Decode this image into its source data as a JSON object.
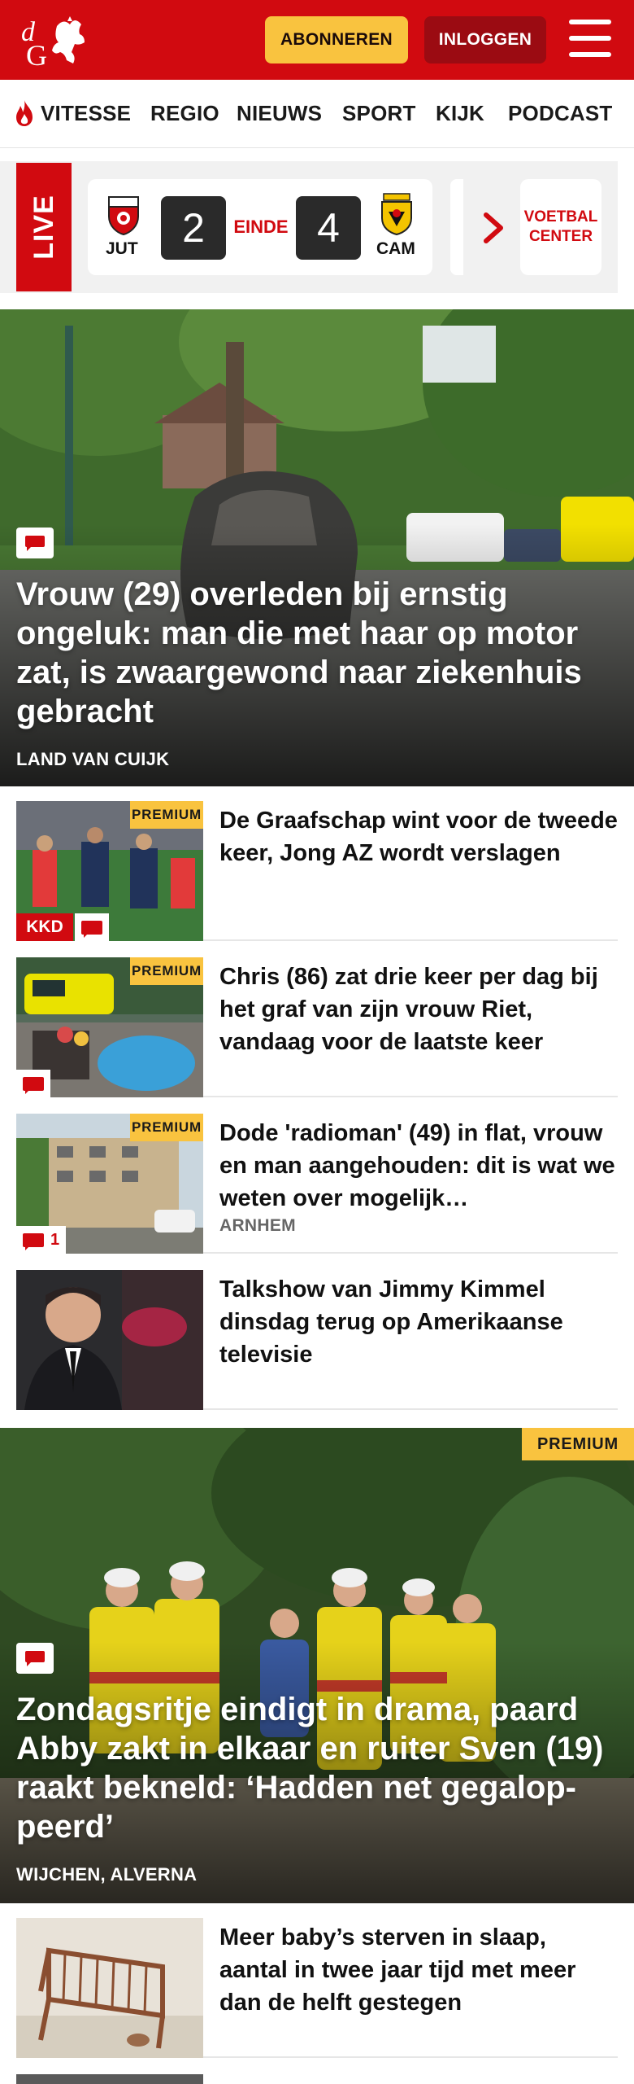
{
  "header": {
    "subscribe_label": "ABONNEREN",
    "login_label": "INLOGGEN",
    "brand_color": "#d10a10",
    "subscribe_color": "#f9c33f"
  },
  "nav": {
    "items": [
      "VITESSE",
      "REGIO",
      "NIEUWS",
      "SPORT",
      "KIJK",
      "PODCAST"
    ]
  },
  "live": {
    "label": "LIVE",
    "home_team": "JUT",
    "away_team": "CAM",
    "home_score": "2",
    "away_score": "4",
    "status": "EINDE",
    "voetbal_center": "VOETBAL CENTER"
  },
  "hero1": {
    "title": "Vrouw (29) overleden bij ernstig ongeluk: man die met haar op motor zat, is zwaargewond naar ziekenhuis gebracht",
    "location": "LAND VAN CUIJK"
  },
  "articles": [
    {
      "title": "De Graafschap wint voor de tweede keer, Jong AZ wordt verslagen",
      "premium": "PREMIUM",
      "badge": "KKD"
    },
    {
      "title": "Chris (86) zat drie keer per dag bij het graf van zijn vrouw Riet, vandaag voor de laatste keer",
      "premium": "PREMIUM"
    },
    {
      "title": "Dode 'radioman' (49) in flat, vrouw en man aangehouden: dit is wat we weten over mogelijk…",
      "premium": "PREMIUM",
      "location": "ARNHEM",
      "comments": "1"
    },
    {
      "title": "Talkshow van Jimmy Kimmel dinsdag terug op Amerikaanse televisie"
    }
  ],
  "hero2": {
    "premium": "PREMIUM",
    "title": "Zondagsritje eindigt in drama, paard Abby zakt in elkaar en ruiter Sven (19) raakt bekneld: ‘Hadden net gegalop-peerd’",
    "location": "WIJCHEN, ALVERNA"
  },
  "article5": {
    "title": "Meer baby’s sterven in slaap, aantal in twee jaar tijd met meer dan de helft gestegen"
  }
}
